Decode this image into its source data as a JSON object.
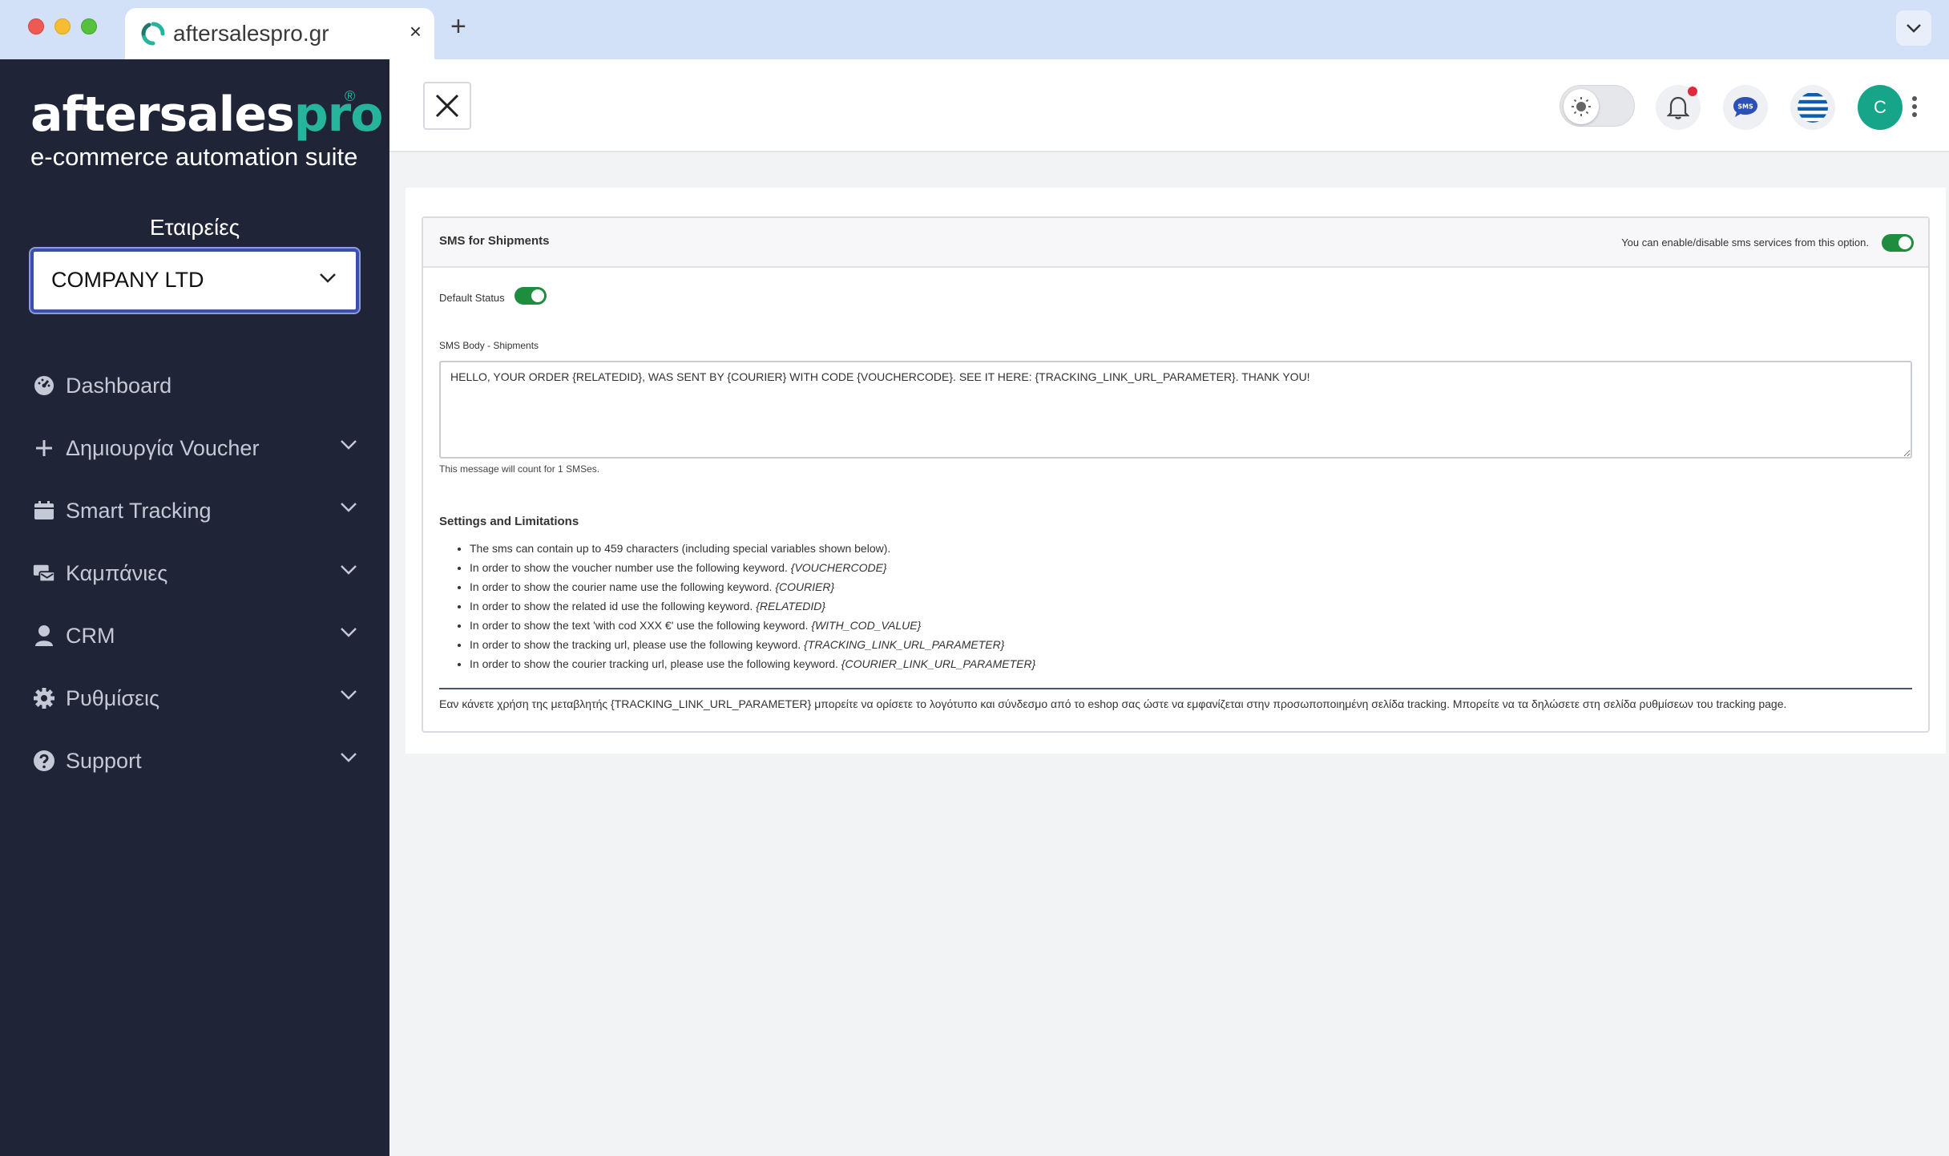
{
  "browser": {
    "tab_title": "aftersalespro.gr",
    "tab_close": "×",
    "new_tab": "+"
  },
  "sidebar": {
    "logo_main": "aftersales",
    "logo_accent": "pro",
    "logo_reg": "®",
    "logo_tagline": "e-commerce automation suite",
    "companies_label": "Εταιρείες",
    "company_selected": "COMPANY LTD",
    "items": [
      {
        "label": "Dashboard",
        "icon": "dashboard-gauge-icon",
        "has_chevron": false
      },
      {
        "label": "Δημιουργία Voucher",
        "icon": "plus-icon",
        "has_chevron": true
      },
      {
        "label": "Smart Tracking",
        "icon": "calendar-icon",
        "has_chevron": true
      },
      {
        "label": "Καμπάνιες",
        "icon": "campaigns-icon",
        "has_chevron": true
      },
      {
        "label": "CRM",
        "icon": "user-icon",
        "has_chevron": true
      },
      {
        "label": "Ρυθμίσεις",
        "icon": "gear-icon",
        "has_chevron": true
      },
      {
        "label": "Support",
        "icon": "question-circle-icon",
        "has_chevron": true
      }
    ]
  },
  "topbar": {
    "avatar_initial": "C",
    "sms_badge": "SMS"
  },
  "panel": {
    "title": "SMS for Shipments",
    "hint": "You can enable/disable sms services from this option.",
    "default_status_label": "Default Status",
    "body_label": "SMS Body - Shipments",
    "body_value": "HELLO, YOUR ORDER {RELATEDID}, WAS SENT BY {COURIER} WITH CODE {VOUCHERCODE}. SEE IT HERE: {TRACKING_LINK_URL_PARAMETER}. THANK YOU!",
    "count_note": "This message will count for 1 SMSes.",
    "settings_title": "Settings and Limitations",
    "rules": [
      {
        "text": "The sms can contain up to 459 characters (including special variables shown below).",
        "keyword": ""
      },
      {
        "text": "In order to show the voucher number use the following keyword. ",
        "keyword": "{VOUCHERCODE}"
      },
      {
        "text": "In order to show the courier name use the following keyword. ",
        "keyword": "{COURIER}"
      },
      {
        "text": "In order to show the related id use the following keyword. ",
        "keyword": "{RELATEDID}"
      },
      {
        "text": "In order to show the text 'with cod XXX €' use the following keyword. ",
        "keyword": "{WITH_COD_VALUE}"
      },
      {
        "text": "In order to show the tracking url, please use the following keyword. ",
        "keyword": "{TRACKING_LINK_URL_PARAMETER}"
      },
      {
        "text": "In order to show the courier tracking url, please use the following keyword. ",
        "keyword": "{COURIER_LINK_URL_PARAMETER}"
      }
    ],
    "footnote": "Εαν κάνετε χρήση της μεταβλητής {TRACKING_LINK_URL_PARAMETER} μπορείτε να ορίσετε το λογότυπο και σύνδεσμο από το eshop σας ώστε να εμφανίζεται στην προσωποποιημένη σελίδα tracking. Μπορείτε να τα δηλώσετε στη σελίδα ρυθμίσεων του tracking page."
  },
  "colors": {
    "sidebar_bg": "#1f2537",
    "accent": "#26b59c",
    "toggle_on": "#1e8e3e",
    "notification": "#e02a3a"
  }
}
